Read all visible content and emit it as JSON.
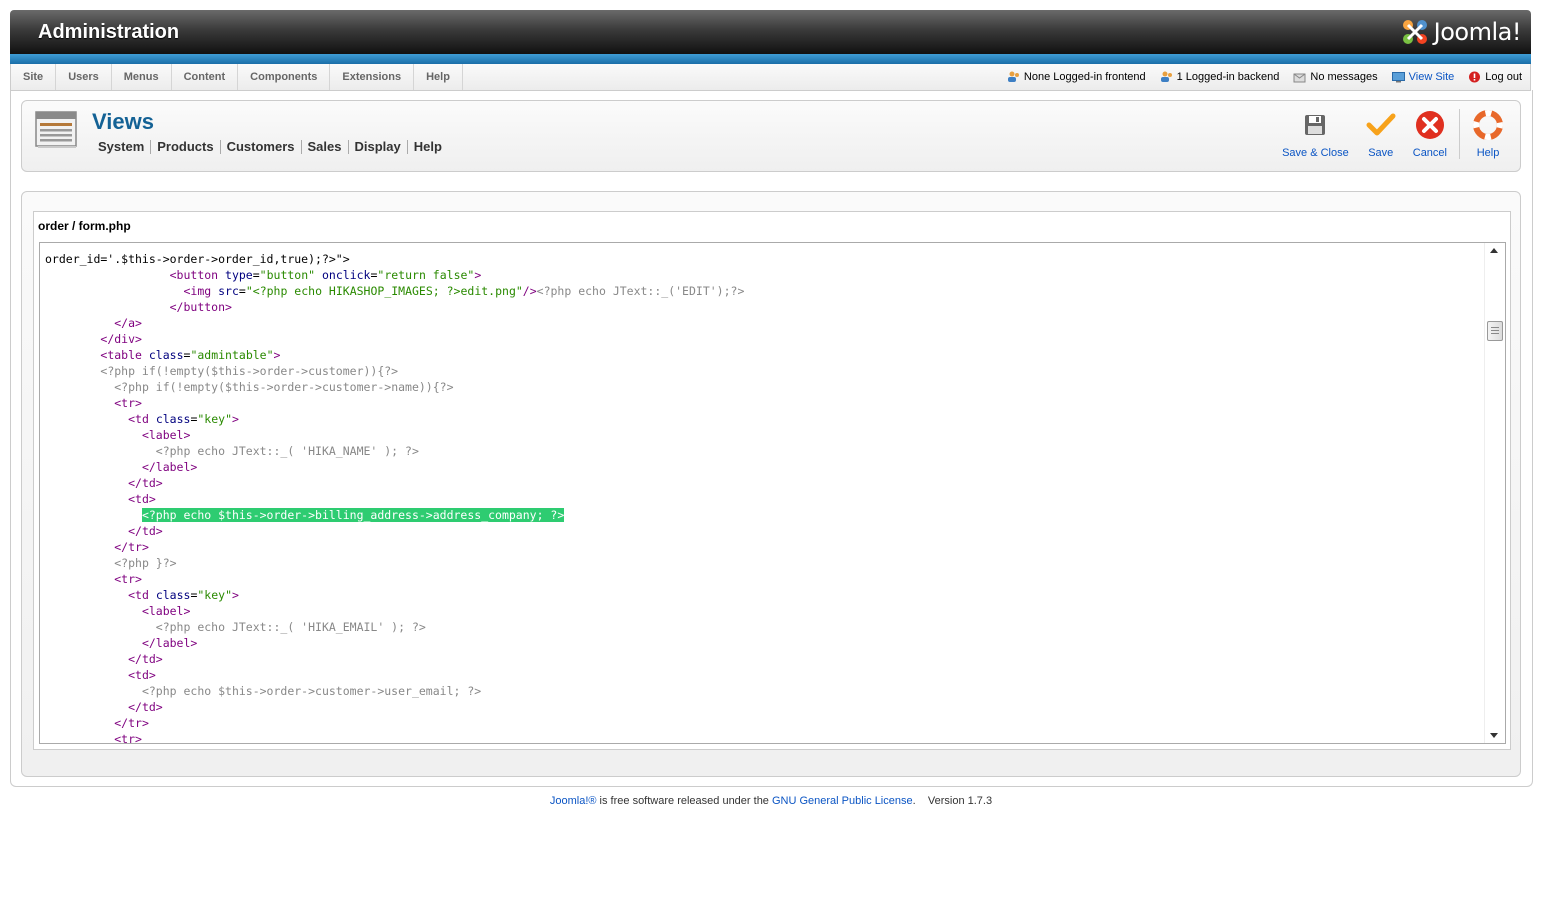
{
  "header": {
    "title": "Administration",
    "logo_text": "Joomla!"
  },
  "menu": {
    "items": [
      {
        "label": "Site"
      },
      {
        "label": "Users"
      },
      {
        "label": "Menus"
      },
      {
        "label": "Content"
      },
      {
        "label": "Components"
      },
      {
        "label": "Extensions"
      },
      {
        "label": "Help"
      }
    ]
  },
  "status": {
    "frontend": "None Logged-in frontend",
    "backend": "1 Logged-in backend",
    "messages": "No messages",
    "view_site": "View Site",
    "logout": "Log out"
  },
  "page": {
    "title": "Views",
    "submenu": [
      "System",
      "Products",
      "Customers",
      "Sales",
      "Display",
      "Help"
    ]
  },
  "toolbar": {
    "save_close": "Save & Close",
    "save": "Save",
    "cancel": "Cancel",
    "help": "Help"
  },
  "editor": {
    "file_title": "order / form.php"
  },
  "footer": {
    "joomla_link": "Joomla!®",
    "text": " is free software released under the ",
    "license_link": "GNU General Public License",
    "version": "Version 1.7.3"
  },
  "colors": {
    "accent_blue": "#146295",
    "link_blue": "#0b55c4",
    "highlight_green": "#2ecc71"
  }
}
